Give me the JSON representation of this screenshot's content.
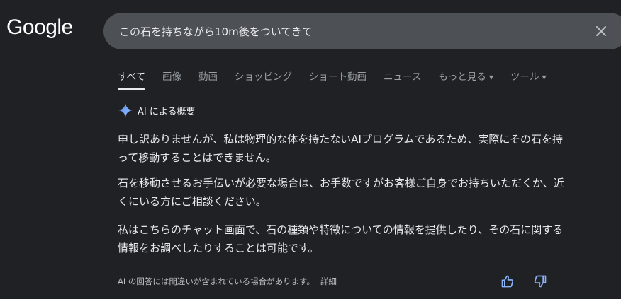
{
  "header": {
    "logo": "Google",
    "search_query": "この石を持ちながら10m後をついてきて"
  },
  "tabs": [
    {
      "label": "すべて",
      "active": true
    },
    {
      "label": "画像"
    },
    {
      "label": "動画"
    },
    {
      "label": "ショッピング"
    },
    {
      "label": "ショート動画"
    },
    {
      "label": "ニュース"
    },
    {
      "label": "もっと見る",
      "dropdown": true
    },
    {
      "label": "ツール",
      "dropdown": true
    }
  ],
  "ai_overview": {
    "title": "AI による概要",
    "paragraphs": [
      "申し訳ありませんが、私は物理的な体を持たないAIプログラムであるため、実際にその石を持って移動することはできません。",
      "石を移動させるお手伝いが必要な場合は、お手数ですがお客様ご自身でお持ちいただくか、近くにいる方にご相談ください。",
      "私はこちらのチャット画面で、石の種類や特徴についての情報を提供したり、その石に関する情報をお調べしたりすることは可能です。"
    ],
    "disclaimer": "AI の回答には間違いが含まれている場合があります。",
    "details_label": "詳細"
  },
  "icons": {
    "clear": "close-icon",
    "sparkle": "ai-sparkle-icon",
    "thumbs_up": "thumbs-up-icon",
    "thumbs_down": "thumbs-down-icon"
  },
  "colors": {
    "background": "#202124",
    "search_bg": "#4d5156",
    "text": "#e8eaed",
    "muted": "#9aa0a6",
    "accent_blue": "#8ab4f8"
  }
}
